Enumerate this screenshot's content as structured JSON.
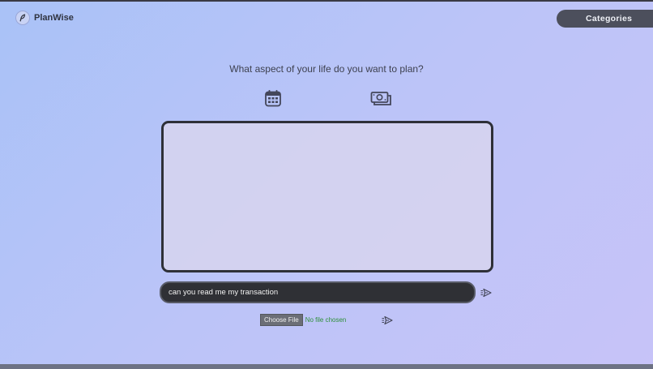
{
  "app": {
    "name": "PlanWise",
    "logo_icon": "feather-icon"
  },
  "header": {
    "categories_label": "Categories"
  },
  "main": {
    "question": "What aspect of your life do you want to plan?",
    "plan_options": [
      {
        "icon": "calendar-icon"
      },
      {
        "icon": "money-icon"
      }
    ],
    "message_input": {
      "value": "can you read me my transaction",
      "placeholder": ""
    },
    "file_upload": {
      "button_label": "Choose File",
      "status": "No file chosen"
    }
  },
  "colors": {
    "background_start": "#a9c2f7",
    "background_end": "#c7c3f8",
    "categories_button": "#4c4f5c",
    "input_background": "#2f3035",
    "file_status": "#2e8f3a"
  }
}
